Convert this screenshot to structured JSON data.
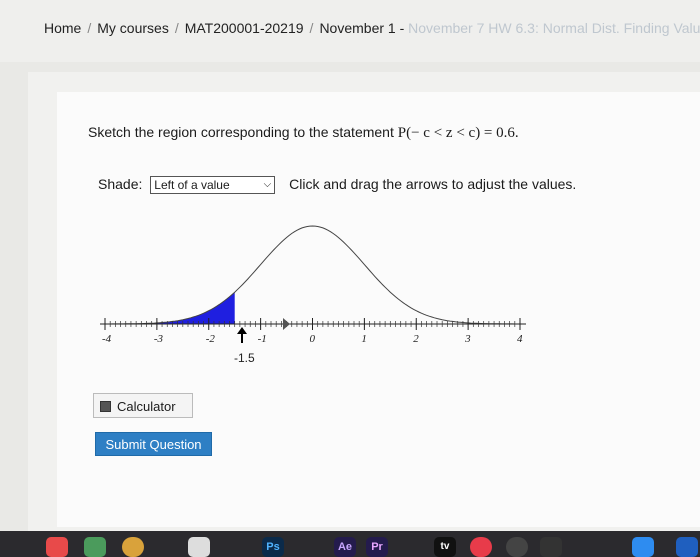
{
  "breadcrumb": {
    "items": [
      "Home",
      "My courses",
      "MAT200001-20219",
      "November 1 -"
    ],
    "faded": "November 7 HW 6.3: Normal Dist. Finding Value"
  },
  "question": {
    "statement_prefix": "Sketch the region corresponding to the statement ",
    "statement_math": "P(− c < z < c) = 0.6.",
    "shade_label": "Shade:",
    "shade_selected": "Left of a value",
    "instruction": "Click and drag the arrows to adjust the values."
  },
  "graph": {
    "x_ticks": [
      "-4",
      "-3",
      "-2",
      "-1",
      "0",
      "1",
      "2",
      "3",
      "4"
    ],
    "handle_value": "-1.5",
    "shade_color": "#1f1fe0",
    "curve": "normal density"
  },
  "buttons": {
    "calculator": "Calculator",
    "submit": "Submit Question"
  },
  "dock": {
    "apps": [
      "calendar-icon",
      "photos-icon",
      "chrome-icon",
      "notes-icon",
      "Ps",
      "Ae",
      "Pr",
      "tv",
      "news-icon",
      "music-icon",
      "app-store-icon"
    ]
  }
}
